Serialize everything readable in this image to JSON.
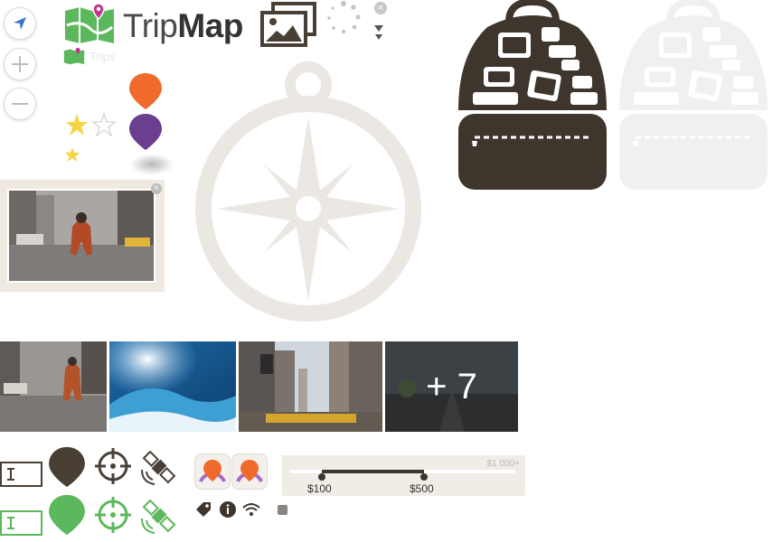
{
  "brand": {
    "title_light": "Trip",
    "title_bold": "Map",
    "subtitle": "Trips"
  },
  "map_controls": [
    {
      "name": "locate-button",
      "icon": "navigation-arrow-icon"
    },
    {
      "name": "zoom-in-button",
      "icon": "plus-icon"
    },
    {
      "name": "zoom-out-button",
      "icon": "minus-icon"
    }
  ],
  "colors": {
    "dark": "#4a3f35",
    "green": "#5cb85c",
    "orange": "#ef6a2c",
    "purple": "#6b3f8f",
    "star": "#f5d547",
    "compass": "#ebe8e4",
    "blue": "#3a76c8"
  },
  "gallery": {
    "more_label": "+ 7"
  },
  "price_slider": {
    "min_label": "$100",
    "max_label": "$500",
    "limit_label": "$1 000+",
    "min_value": 100,
    "max_value": 500,
    "limit_value": 1000
  },
  "rating": {
    "value": 1,
    "max": 2
  }
}
